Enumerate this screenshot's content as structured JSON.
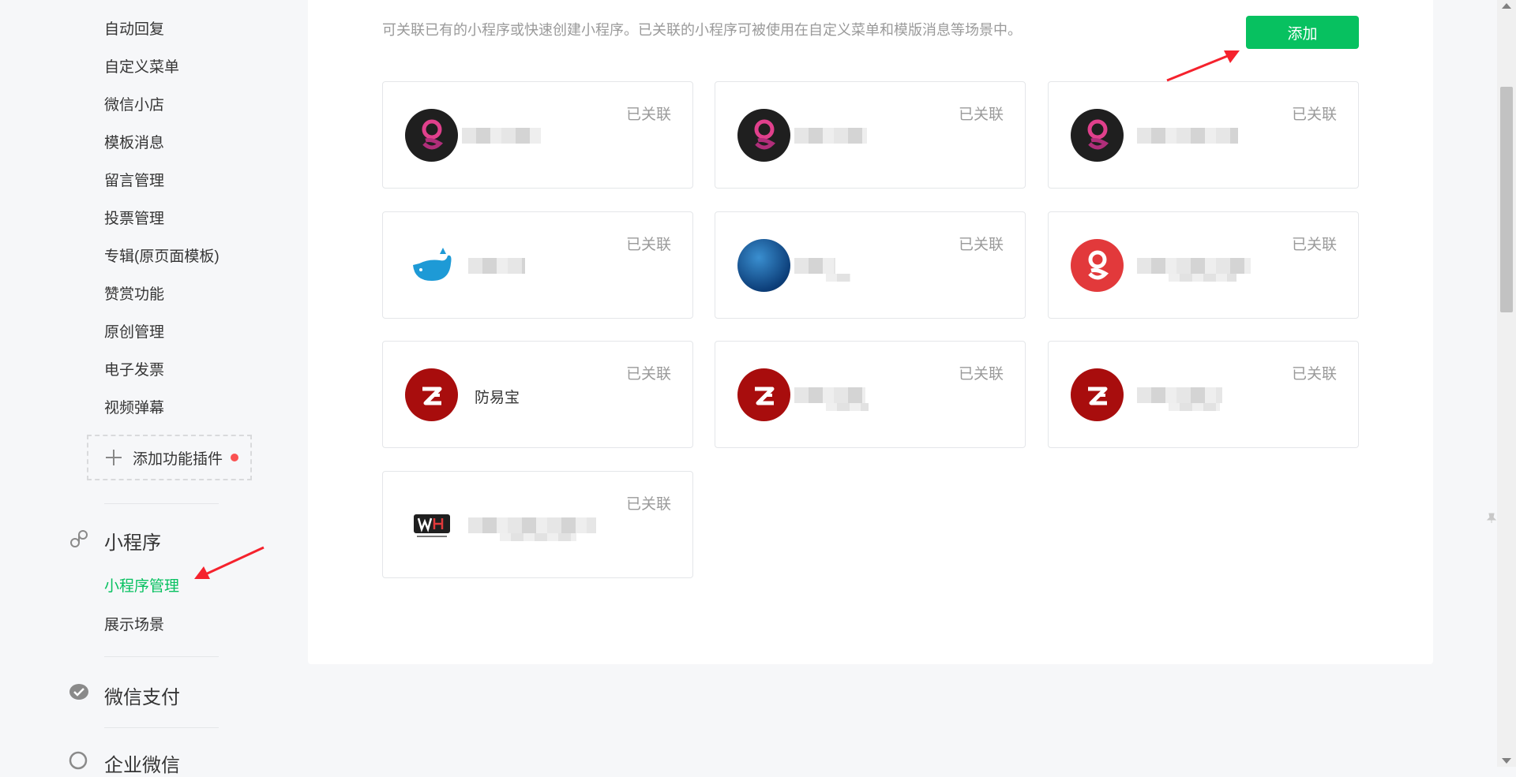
{
  "sidebar": {
    "items": [
      {
        "label": "自动回复"
      },
      {
        "label": "自定义菜单"
      },
      {
        "label": "微信小店"
      },
      {
        "label": "模板消息"
      },
      {
        "label": "留言管理"
      },
      {
        "label": "投票管理"
      },
      {
        "label": "专辑(原页面模板)"
      },
      {
        "label": "赞赏功能"
      },
      {
        "label": "原创管理"
      },
      {
        "label": "电子发票"
      },
      {
        "label": "视频弹幕"
      }
    ],
    "add_plugin_label": "添加功能插件",
    "mini_program": {
      "title": "小程序",
      "items": [
        {
          "label": "小程序管理",
          "active": true
        },
        {
          "label": "展示场景"
        }
      ]
    },
    "wechat_pay": {
      "title": "微信支付"
    },
    "wecom": {
      "title": "企业微信"
    }
  },
  "main": {
    "description": "可关联已有的小程序或快速创建小程序。已关联的小程序可被使用在自定义菜单和模版消息等场景中。",
    "add_button_label": "添加",
    "cards": [
      {
        "status": "已关联",
        "name": "",
        "icon": "g-dark-logo"
      },
      {
        "status": "已关联",
        "name": "",
        "icon": "g-dark-logo"
      },
      {
        "status": "已关联",
        "name": "",
        "icon": "g-dark-logo"
      },
      {
        "status": "已关联",
        "name": "",
        "icon": "whale-logo"
      },
      {
        "status": "已关联",
        "name": "",
        "icon": "ocean-logo"
      },
      {
        "status": "已关联",
        "name": "",
        "icon": "g-red-logo"
      },
      {
        "status": "已关联",
        "name": "防易宝",
        "icon": "fyb-logo"
      },
      {
        "status": "已关联",
        "name": "",
        "icon": "fyb-logo"
      },
      {
        "status": "已关联",
        "name": "",
        "icon": "fyb-logo"
      },
      {
        "status": "已关联",
        "name": "",
        "icon": "wh-logo"
      }
    ]
  },
  "colors": {
    "accent": "#07c160",
    "annotation": "#f5222d",
    "muted_text": "#9a9a9a"
  }
}
